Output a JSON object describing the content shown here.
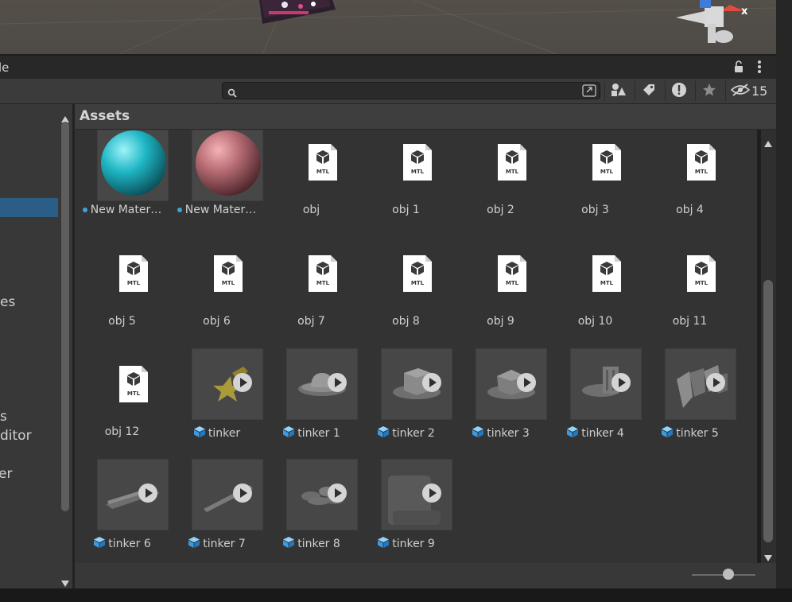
{
  "panel": {
    "title": "le"
  },
  "toolbar": {
    "search_placeholder": "",
    "hidden_count": "15"
  },
  "sidebar": {
    "items": [
      "es",
      "s",
      "ditor",
      "er"
    ]
  },
  "assets": {
    "title": "Assets",
    "items": [
      {
        "label": "New Mater…",
        "kind": "material",
        "color": "#1fb7c5"
      },
      {
        "label": "New Mater…",
        "kind": "material",
        "color": "#b56a72"
      },
      {
        "label": "obj",
        "kind": "mtl"
      },
      {
        "label": "obj 1",
        "kind": "mtl"
      },
      {
        "label": "obj 2",
        "kind": "mtl"
      },
      {
        "label": "obj 3",
        "kind": "mtl"
      },
      {
        "label": "obj 4",
        "kind": "mtl"
      },
      {
        "label": "obj 5",
        "kind": "mtl"
      },
      {
        "label": "obj 6",
        "kind": "mtl"
      },
      {
        "label": "obj 7",
        "kind": "mtl"
      },
      {
        "label": "obj 8",
        "kind": "mtl"
      },
      {
        "label": "obj 9",
        "kind": "mtl"
      },
      {
        "label": "obj 10",
        "kind": "mtl"
      },
      {
        "label": "obj 11",
        "kind": "mtl"
      },
      {
        "label": "obj 12",
        "kind": "mtl"
      },
      {
        "label": "tinker",
        "kind": "model"
      },
      {
        "label": "tinker 1",
        "kind": "model"
      },
      {
        "label": "tinker 2",
        "kind": "model"
      },
      {
        "label": "tinker 3",
        "kind": "model"
      },
      {
        "label": "tinker 4",
        "kind": "model"
      },
      {
        "label": "tinker 5",
        "kind": "model"
      },
      {
        "label": "tinker 6",
        "kind": "model"
      },
      {
        "label": "tinker 7",
        "kind": "model"
      },
      {
        "label": "tinker 8",
        "kind": "model"
      },
      {
        "label": "tinker 9",
        "kind": "model"
      }
    ]
  },
  "mtl_icon_text": "MTL",
  "gizmo_axis_label": "x",
  "colors": {
    "accent": "#2c5d87",
    "background": "#333333"
  }
}
